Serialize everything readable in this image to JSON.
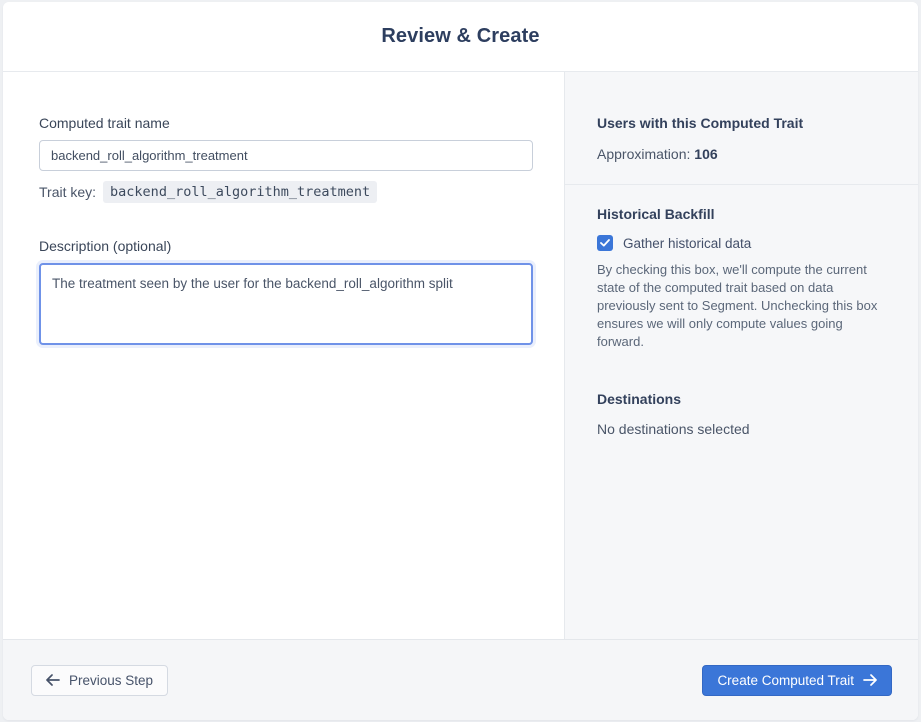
{
  "header": {
    "title": "Review & Create"
  },
  "form": {
    "name_label": "Computed trait name",
    "name_value": "backend_roll_algorithm_treatment",
    "trait_key_label": "Trait key:",
    "trait_key_value": "backend_roll_algorithm_treatment",
    "description_label": "Description (optional)",
    "description_value": "The treatment seen by the user for the backend_roll_algorithm split"
  },
  "summary": {
    "users_heading": "Users with this Computed Trait",
    "approximation_label": "Approximation:",
    "approximation_value": "106",
    "backfill_heading": "Historical Backfill",
    "backfill_checkbox_label": "Gather historical data",
    "backfill_checked": "true",
    "backfill_description": "By checking this box, we'll compute the current state of the computed trait based on data previously sent to Segment. Unchecking this box ensures we will only compute values going forward.",
    "destinations_heading": "Destinations",
    "destinations_value": "No destinations selected"
  },
  "footer": {
    "previous_label": "Previous Step",
    "create_label": "Create Computed Trait"
  },
  "colors": {
    "accent_blue": "#3b76d8",
    "panel_bg": "#f6f7f9",
    "heading_text": "#2d3e5f"
  }
}
